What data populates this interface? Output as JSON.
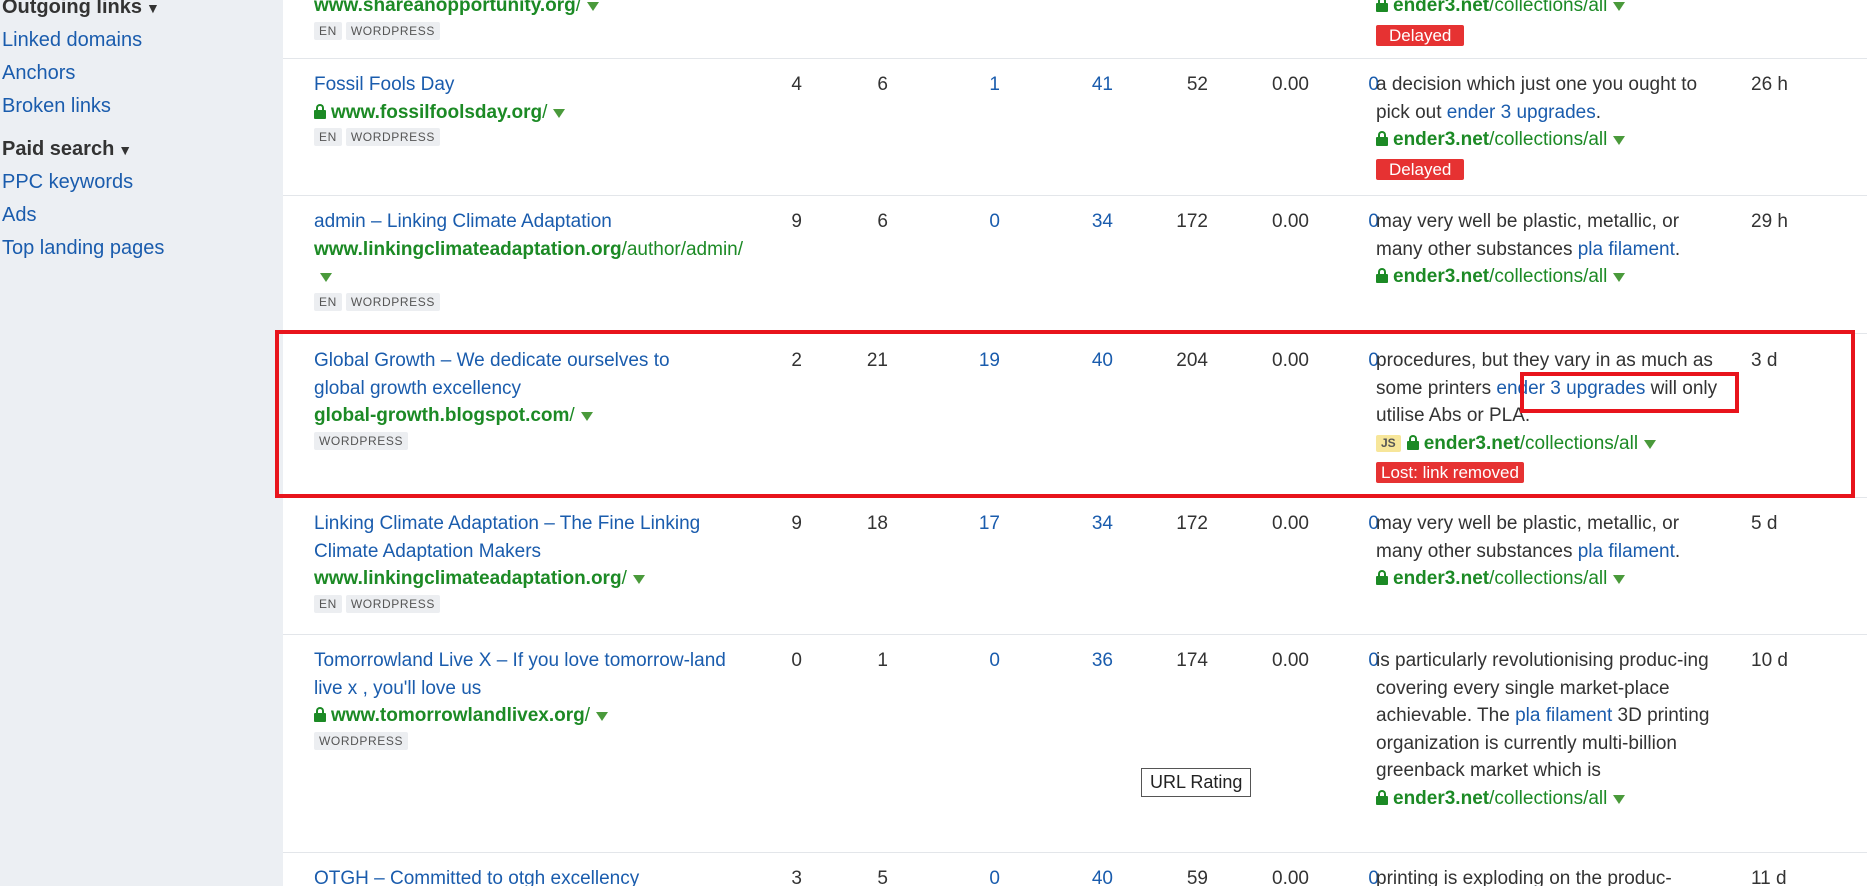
{
  "sidebar": {
    "sections": [
      {
        "heading": "Outgoing links",
        "items": [
          "Linked domains",
          "Anchors",
          "Broken links"
        ]
      },
      {
        "heading": "Paid search",
        "items": [
          "PPC keywords",
          "Ads",
          "Top landing pages"
        ]
      }
    ]
  },
  "rows": [
    {
      "title": "",
      "url_domain": "www.shareanopportunity.org",
      "url_path": "/",
      "secure": false,
      "tags": [
        "EN",
        "WORDPRESS"
      ],
      "nums": [
        "",
        "",
        "",
        "",
        "",
        "",
        ""
      ],
      "anchor_text_parts": [],
      "anchor_link": "",
      "js": false,
      "target_domain": "ender3.net",
      "target_path": "/collections/all",
      "status": "Delayed",
      "time": ""
    },
    {
      "title": "Fossil Fools Day",
      "url_domain": "www.fossilfoolsday.org",
      "url_path": "/",
      "secure": true,
      "tags": [
        "EN",
        "WORDPRESS"
      ],
      "nums": [
        "4",
        "6",
        "1",
        "41",
        "52",
        "0.00",
        "0"
      ],
      "anchor_before": "a decision which just one you ought to pick out ",
      "anchor_link": "ender 3 upgrades",
      "anchor_after": ".",
      "js": false,
      "target_domain": "ender3.net",
      "target_path": "/collections/all",
      "status": "Delayed",
      "time": "26 h"
    },
    {
      "title": "admin – Linking Climate Adaptation",
      "url_domain": "www.linkingclimateadaptation.org",
      "url_path": "/author/admin/",
      "secure": false,
      "tags": [
        "EN",
        "WORDPRESS"
      ],
      "nums": [
        "9",
        "6",
        "0",
        "34",
        "172",
        "0.00",
        "0"
      ],
      "anchor_before": "may very well be plastic, metallic, or many other substances ",
      "anchor_link": "pla filament",
      "anchor_after": ".",
      "js": false,
      "target_domain": "ender3.net",
      "target_path": "/collections/all",
      "status": "",
      "time": "29 h"
    },
    {
      "title": "Global Growth – We dedicate ourselves to global growth excellency",
      "url_domain": "global-growth.blogspot.com",
      "url_path": "/",
      "secure": false,
      "tags": [
        "WORDPRESS"
      ],
      "nums": [
        "2",
        "21",
        "19",
        "40",
        "204",
        "0.00",
        "0"
      ],
      "anchor_before": "procedures, but they vary in as much as some printers ",
      "anchor_link": "ender 3 upgrades",
      "anchor_after": " will only utilise Abs or PLA.",
      "js": true,
      "js_label": "JS",
      "target_domain": "ender3.net",
      "target_path": "/collections/all",
      "status": "Lost: link removed",
      "time": "3 d"
    },
    {
      "title": "Linking Climate Adaptation – The Fine Linking Climate Adaptation Makers",
      "url_domain": "www.linkingclimateadaptation.org",
      "url_path": "/",
      "secure": false,
      "tags": [
        "EN",
        "WORDPRESS"
      ],
      "nums": [
        "9",
        "18",
        "17",
        "34",
        "172",
        "0.00",
        "0"
      ],
      "anchor_before": "may very well be plastic, metallic, or many other substances ",
      "anchor_link": "pla filament",
      "anchor_after": ".",
      "js": false,
      "target_domain": "ender3.net",
      "target_path": "/collections/all",
      "status": "",
      "time": "5 d"
    },
    {
      "title": "Tomorrowland Live X – If you love tomorrow-land live x , you'll love us",
      "url_domain": "www.tomorrowlandlivex.org",
      "url_path": "/",
      "secure": true,
      "tags": [
        "WORDPRESS"
      ],
      "nums": [
        "0",
        "1",
        "0",
        "36",
        "174",
        "0.00",
        "0"
      ],
      "anchor_before": "is particularly revolutionising produc-ing covering every single market-place achievable. The ",
      "anchor_link": "pla filament",
      "anchor_after": " 3D printing organization is currently multi-billion greenback market which is",
      "js": false,
      "target_domain": "ender3.net",
      "target_path": "/collections/all",
      "status": "",
      "time": "10 d"
    },
    {
      "title": "OTGH – Committed to otgh excellency",
      "url_domain": "",
      "url_path": "",
      "secure": false,
      "tags": [],
      "nums": [
        "3",
        "5",
        "0",
        "40",
        "59",
        "0.00",
        "0"
      ],
      "anchor_before": "printing is exploding on the produc-",
      "anchor_link": "",
      "anchor_after": "",
      "js": false,
      "target_domain": "",
      "target_path": "",
      "status": "",
      "time": "11 d"
    }
  ],
  "tooltip": "URL Rating",
  "colors": {
    "link": "#1a5cad",
    "url_green": "#1c8a25",
    "badge_red": "#e63232",
    "highlight_red": "#e8141c"
  }
}
